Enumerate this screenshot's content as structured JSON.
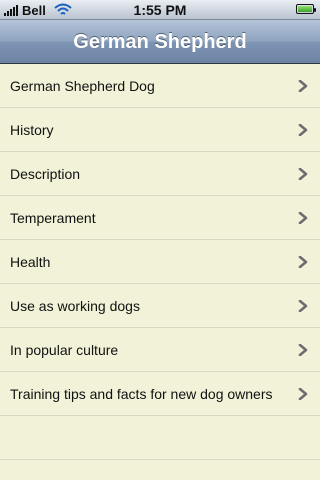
{
  "status_bar": {
    "carrier": "Bell",
    "time": "1:55 PM"
  },
  "nav": {
    "title": "German Shepherd"
  },
  "list": {
    "items": [
      {
        "label": "German Shepherd Dog"
      },
      {
        "label": "History"
      },
      {
        "label": "Description"
      },
      {
        "label": "Temperament"
      },
      {
        "label": "Health"
      },
      {
        "label": "Use as working dogs"
      },
      {
        "label": "In popular culture"
      },
      {
        "label": "Training tips and facts for new dog owners"
      }
    ],
    "chevron_icon": "chevron-right-icon"
  },
  "colors": {
    "background": "#f2f2d8",
    "navbar": "#7e94b3",
    "row_divider": "#d9d9c2"
  }
}
